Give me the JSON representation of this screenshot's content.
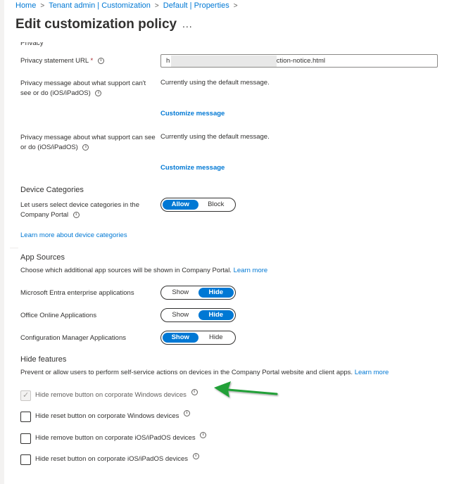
{
  "breadcrumb": [
    "Home",
    "Tenant admin | Customization",
    "Default | Properties"
  ],
  "page_title": "Edit customization policy",
  "title_more": "...",
  "clipped_heading": "Privacy",
  "privacy_url": {
    "label": "Privacy statement URL",
    "required_mark": "*",
    "value": "h                                              a-protection-notice.html"
  },
  "privacy_msg_1": {
    "label": "Privacy message about what support can't see or do (iOS/iPadOS)",
    "value": "Currently using the default message.",
    "link": "Customize message"
  },
  "privacy_msg_2": {
    "label": "Privacy message about what support can see or do (iOS/iPadOS)",
    "value": "Currently using the default message.",
    "link": "Customize message"
  },
  "device_categories": {
    "heading": "Device Categories",
    "label": "Let users select device categories in the Company Portal",
    "options": [
      "Allow",
      "Block"
    ],
    "selected": "Allow",
    "learn_more": "Learn more about device categories"
  },
  "app_sources": {
    "heading": "App Sources",
    "description": "Choose which additional app sources will be shown in Company Portal.",
    "learn_more": "Learn more",
    "rows": [
      {
        "label": "Microsoft Entra enterprise applications",
        "options": [
          "Show",
          "Hide"
        ],
        "selected": "Hide"
      },
      {
        "label": "Office Online Applications",
        "options": [
          "Show",
          "Hide"
        ],
        "selected": "Hide"
      },
      {
        "label": "Configuration Manager Applications",
        "options": [
          "Show",
          "Hide"
        ],
        "selected": "Show"
      }
    ]
  },
  "hide_features": {
    "heading": "Hide features",
    "description": "Prevent or allow users to perform self-service actions on devices in the Company Portal website and client apps.",
    "learn_more": "Learn more",
    "items": [
      {
        "label": "Hide remove button on corporate Windows devices",
        "checked": true,
        "disabled": true
      },
      {
        "label": "Hide reset button on corporate Windows devices",
        "checked": false,
        "disabled": false
      },
      {
        "label": "Hide remove button on corporate iOS/iPadOS devices",
        "checked": false,
        "disabled": false
      },
      {
        "label": "Hide reset button on corporate iOS/iPadOS devices",
        "checked": false,
        "disabled": false
      }
    ]
  },
  "colors": {
    "accent": "#0078d4",
    "annotation_arrow": "#21a038"
  },
  "icons": {
    "info": "info-circle-icon",
    "breadcrumb_separator": "chevron-right-icon",
    "annotation": "green-arrow-icon"
  }
}
